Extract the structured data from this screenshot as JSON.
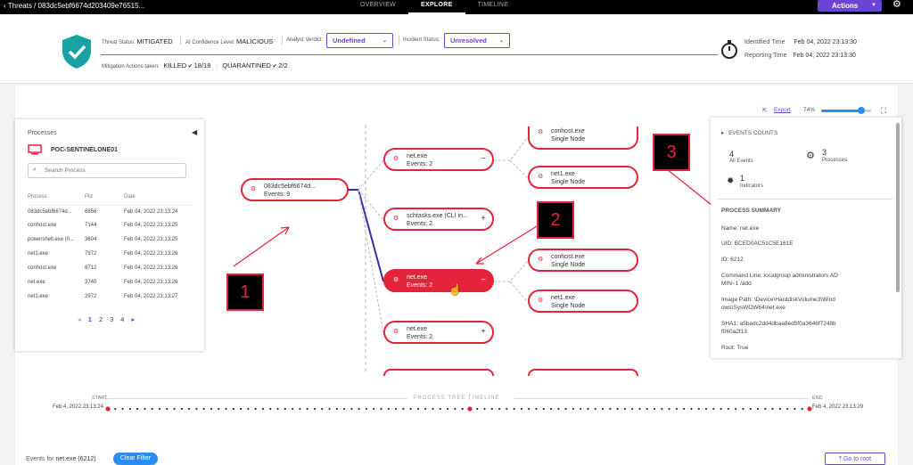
{
  "topbar": {
    "breadcrumb": "Threats / 083dc5ebf6674d203409e76515...",
    "tabs": [
      "OVERVIEW",
      "EXPLORE",
      "TIMELINE"
    ],
    "actions_label": "Actions"
  },
  "threat": {
    "status_label": "Threat Status:",
    "status_value": "MITIGATED",
    "confidence_label": "AI Confidence Level:",
    "confidence_value": "MALICIOUS",
    "verdict_label": "Analyst Verdict:",
    "verdict_value": "Undefined",
    "incident_label": "Incident Status:",
    "incident_value": "Unresolved",
    "mitigation_label": "Mitigation Actions taken:",
    "killed_label": "KILLED",
    "killed_count": "18/18",
    "quarantined_label": "QUARANTINED",
    "quarantined_count": "2/2",
    "identified_label": "Identified Time",
    "identified_value": "Feb 04, 2022 23:13:30",
    "reporting_label": "Reporting Time",
    "reporting_value": "Feb 04, 2022 23:13:30"
  },
  "processes": {
    "title": "Processes",
    "host": "POC-SENTINELONE01",
    "search_placeholder": "Search Process",
    "columns": [
      "Process",
      "Pid",
      "Date"
    ],
    "rows": [
      [
        "083dc5ebf6674d...",
        "6856",
        "Feb 04, 2022 23:13:24"
      ],
      [
        "conhost.exe",
        "7144",
        "Feb 04, 2022 23:13:25"
      ],
      [
        "powershell.exe (0...",
        "3604",
        "Feb 04, 2022 23:13:25"
      ],
      [
        "net1.exe",
        "7972",
        "Feb 04, 2022 23:13:26"
      ],
      [
        "conhost.exe",
        "8712",
        "Feb 04, 2022 23:13:26"
      ],
      [
        "net.exe",
        "3740",
        "Feb 04, 2022 23:13:26"
      ],
      [
        "net1.exe",
        "2972",
        "Feb 04, 2022 23:13:27"
      ]
    ],
    "pages": [
      "1",
      "2",
      "3",
      "4"
    ]
  },
  "tree": {
    "root": {
      "name": "083dc5ebf6674d...",
      "sub": "Events: 9"
    },
    "nodes": [
      {
        "name": "net.exe",
        "sub": "Events: 2",
        "pm": "−"
      },
      {
        "name": "schtasks.exe (CLI in...",
        "sub": "Events: 2",
        "pm": "+"
      },
      {
        "name": "net.exe",
        "sub": "Events: 2",
        "pm": "−"
      },
      {
        "name": "net.exe",
        "sub": "Events: 2",
        "pm": "+"
      }
    ],
    "children": [
      {
        "name": "conhost.exe",
        "sub": "Single Node"
      },
      {
        "name": "net1.exe",
        "sub": "Single Node"
      },
      {
        "name": "conhost.exe",
        "sub": "Single Node"
      },
      {
        "name": "net1.exe",
        "sub": "Single Node"
      }
    ]
  },
  "toolbar": {
    "export_label": "Export",
    "zoom": "74%",
    "zoom_fraction": 0.8
  },
  "summary": {
    "counts_title": "EVENTS COUNTS",
    "all_events": "4",
    "all_events_label": "All Events",
    "processes": "3",
    "processes_label": "Processes",
    "indicators": "1",
    "indicators_label": "Indicators",
    "section_title": "PROCESS SUMMARY",
    "name": "Name: net.exe",
    "uid": "UID: BCED0AC51C5E161E",
    "id": "ID: 6212",
    "cmd1": "Command Line: localgroup administrators AD",
    "cmd2": "MIN~1 /add",
    "img1": "Image Path: \\Device\\HarddiskVolume3\\Wind",
    "img2": "ows\\SysWOW64\\net.exe",
    "sha1": "SHA1: a5badc2dd4dbaa8ed5f0a3646f7248b",
    "sha2": "f060a2f13",
    "root": "Root: True"
  },
  "timeline": {
    "title": "PROCESS TREE TIMELINE",
    "start_label": "START",
    "start_value": "Feb 4, 2022 23:13:24",
    "end_label": "END",
    "end_value": "Feb 4, 2022 23:13:29"
  },
  "bottom": {
    "events_for": "Events for",
    "events_target": "net.exe (6212)",
    "clear_filter": "Clear Filter",
    "go_to_root": "Go to root"
  },
  "callouts": [
    "1",
    "2",
    "3"
  ],
  "colors": {
    "accent": "#6b43d6",
    "danger": "#e3243a",
    "teal": "#17a2a5",
    "link": "#2d8cf0"
  }
}
